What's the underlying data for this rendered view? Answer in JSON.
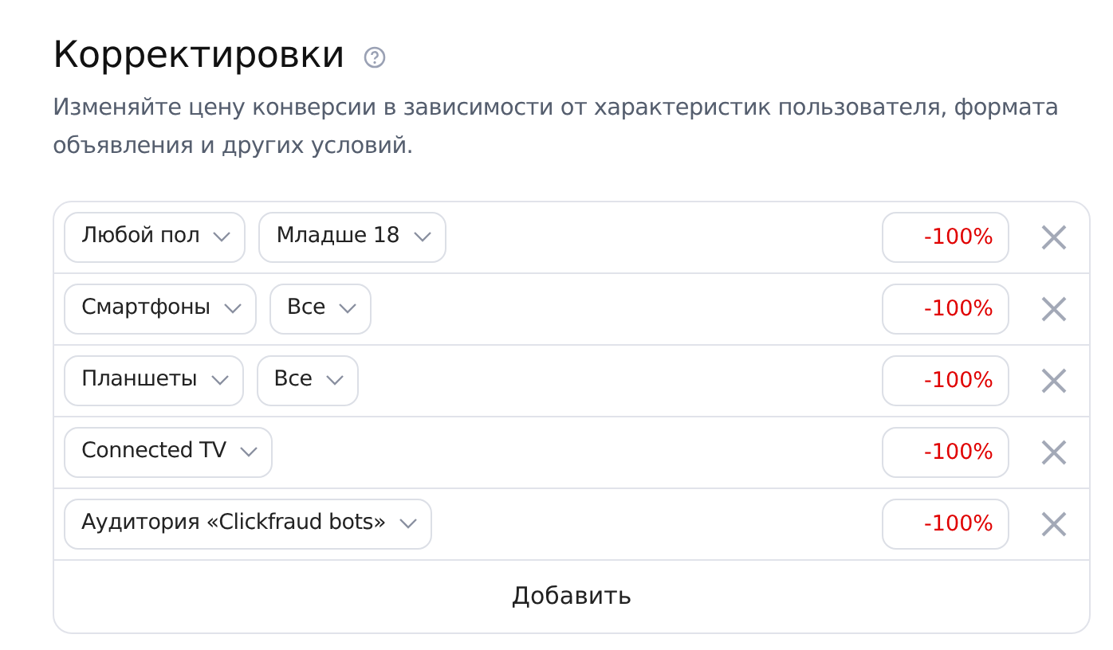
{
  "title": "Корректировки",
  "description": "Изменяйте цену конверсии в зависимости от характеристик пользователя, формата объявления и других условий.",
  "adjustments": [
    {
      "selects": [
        "Любой пол",
        "Младше 18"
      ],
      "value": "-100%"
    },
    {
      "selects": [
        "Смартфоны",
        "Все"
      ],
      "value": "-100%"
    },
    {
      "selects": [
        "Планшеты",
        "Все"
      ],
      "value": "-100%"
    },
    {
      "selects": [
        "Connected TV"
      ],
      "value": "-100%"
    },
    {
      "selects": [
        "Аудитория «Clickfraud bots»"
      ],
      "value": "-100%"
    }
  ],
  "add_button": "Добавить"
}
